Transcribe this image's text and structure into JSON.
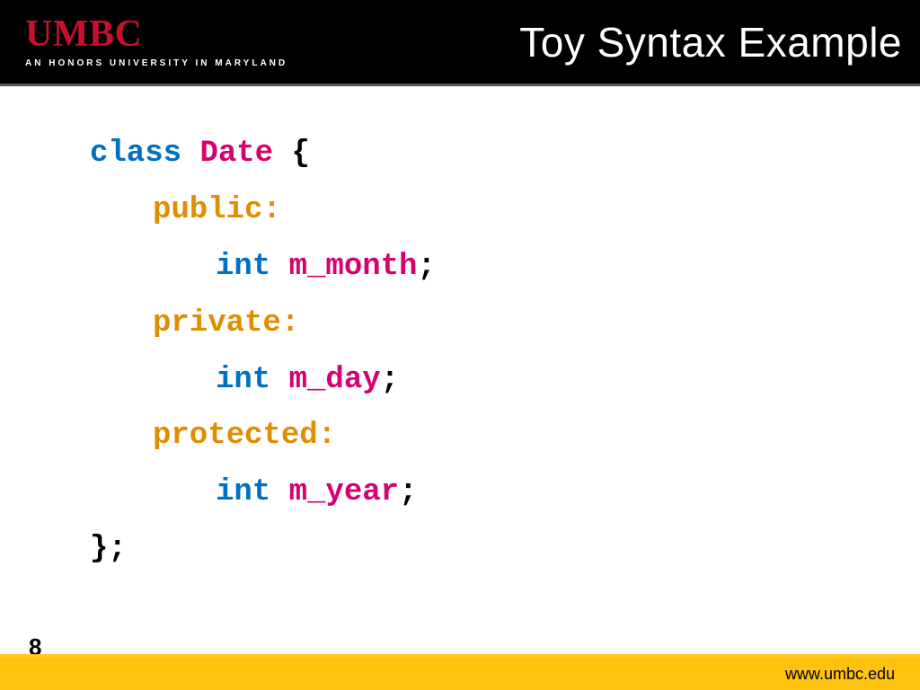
{
  "header": {
    "logo_main": "UMBC",
    "logo_sub": "AN HONORS UNIVERSITY IN MARYLAND",
    "title": "Toy Syntax Example"
  },
  "code": {
    "kw_class": "class",
    "class_name": "Date",
    "open_brace": " {",
    "public_label": "public",
    "private_label": "private",
    "protected_label": "protected",
    "colon": ":",
    "type_int": "int",
    "member_month": "m_month",
    "member_day": "m_day",
    "member_year": "m_year",
    "semicolon": ";",
    "close": "};"
  },
  "footer": {
    "page_number": "8",
    "url": "www.umbc.edu"
  }
}
